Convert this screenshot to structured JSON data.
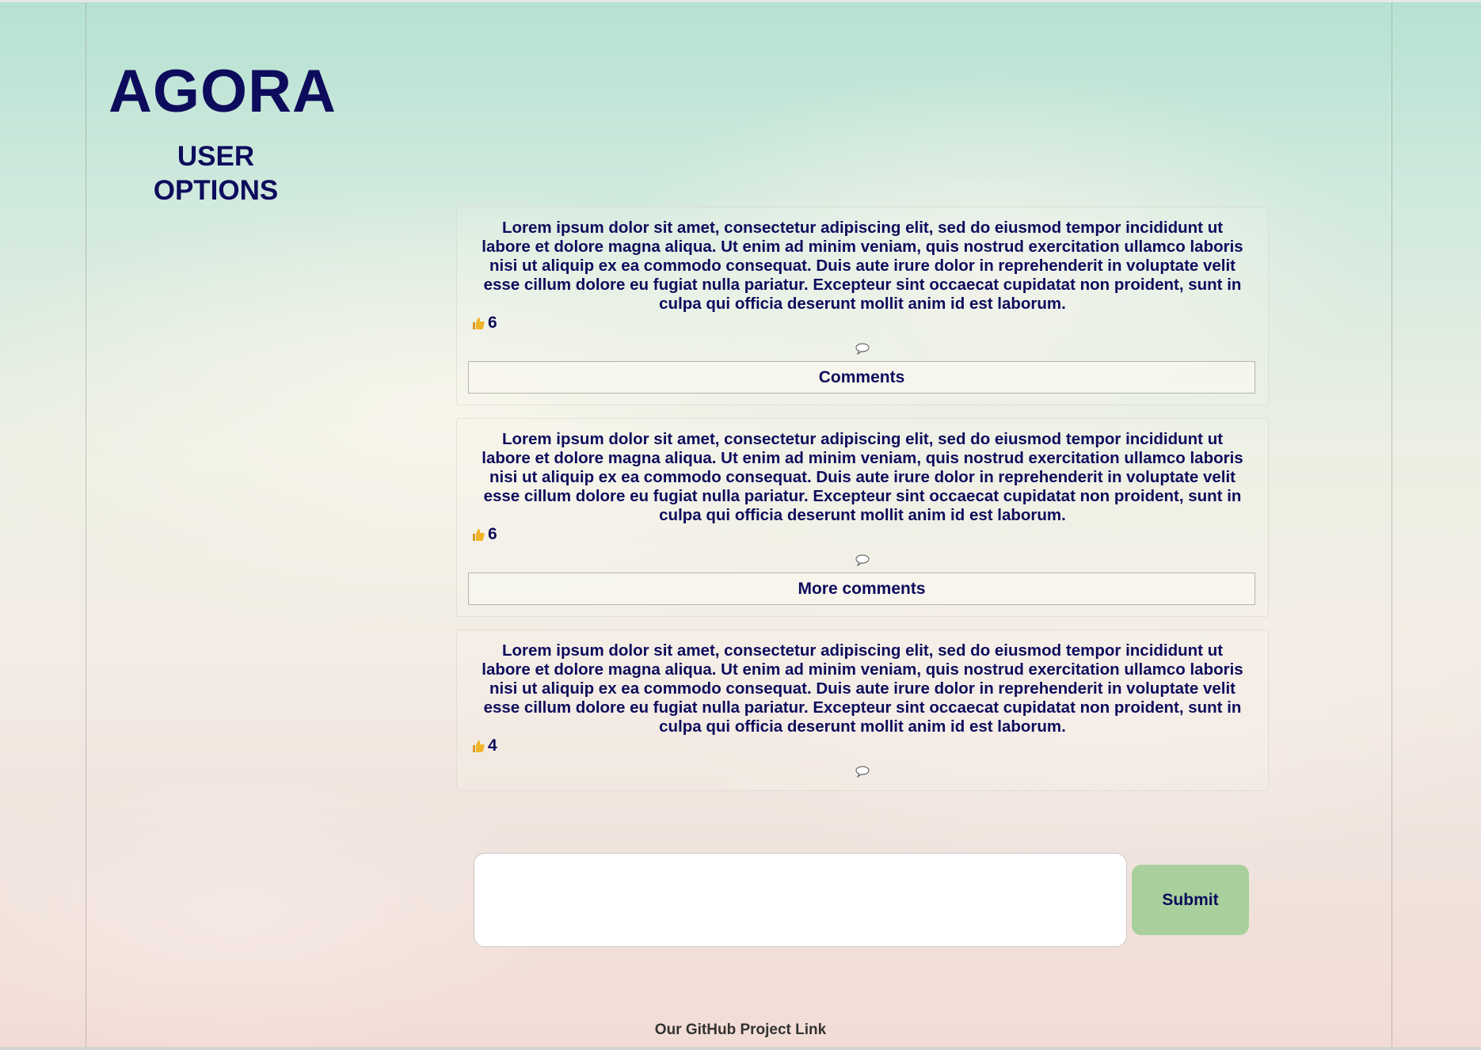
{
  "brand": {
    "title": "AGORA"
  },
  "sidebar": {
    "user_options_label": "USER OPTIONS"
  },
  "posts": [
    {
      "text": "Lorem ipsum dolor sit amet, consectetur adipiscing elit, sed do eiusmod tempor incididunt ut labore et dolore magna aliqua. Ut enim ad minim veniam, quis nostrud exercitation ullamco laboris nisi ut aliquip ex ea commodo consequat. Duis aute irure dolor in reprehenderit in voluptate velit esse cillum dolore eu fugiat nulla pariatur. Excepteur sint occaecat cupidatat non proident, sunt in culpa qui officia deserunt mollit anim id est laborum.",
      "likes": "6",
      "like_icon": "thumbs-up-icon",
      "comment_icon": "speech-bubble-icon",
      "comments_button": "Comments"
    },
    {
      "text": "Lorem ipsum dolor sit amet, consectetur adipiscing elit, sed do eiusmod tempor incididunt ut labore et dolore magna aliqua. Ut enim ad minim veniam, quis nostrud exercitation ullamco laboris nisi ut aliquip ex ea commodo consequat. Duis aute irure dolor in reprehenderit in voluptate velit esse cillum dolore eu fugiat nulla pariatur. Excepteur sint occaecat cupidatat non proident, sunt in culpa qui officia deserunt mollit anim id est laborum.",
      "likes": "6",
      "like_icon": "thumbs-up-icon",
      "comment_icon": "speech-bubble-icon",
      "comments_button": "More comments"
    },
    {
      "text": "Lorem ipsum dolor sit amet, consectetur adipiscing elit, sed do eiusmod tempor incididunt ut labore et dolore magna aliqua. Ut enim ad minim veniam, quis nostrud exercitation ullamco laboris nisi ut aliquip ex ea commodo consequat. Duis aute irure dolor in reprehenderit in voluptate velit esse cillum dolore eu fugiat nulla pariatur. Excepteur sint occaecat cupidatat non proident, sunt in culpa qui officia deserunt mollit anim id est laborum.",
      "likes": "4",
      "like_icon": "thumbs-up-icon",
      "comment_icon": "speech-bubble-icon"
    }
  ],
  "composer": {
    "value": "",
    "placeholder": "",
    "submit_label": "Submit"
  },
  "footer": {
    "link_text": "Our GitHub Project Link"
  },
  "colors": {
    "text_primary": "#0d0c5c",
    "submit_button": "#a9d09c",
    "footer_text": "#333333",
    "like_icon": "#f0b428"
  }
}
